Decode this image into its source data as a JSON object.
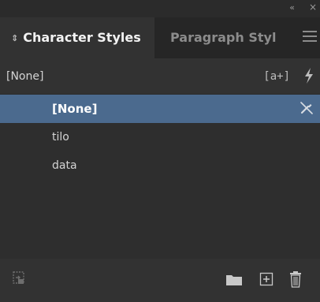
{
  "window": {
    "collapse_glyph": "«",
    "close_glyph": "×"
  },
  "tabs": [
    {
      "label": "Character Styles",
      "active": true,
      "icon": "sort-icon",
      "icon_glyph": "⇕"
    },
    {
      "label": "Paragraph Styl",
      "active": false
    }
  ],
  "menu_icon": "hamburger-menu-icon",
  "header": {
    "current_style": "[None]",
    "new_style_glyph": "[a+]",
    "new_style_icon": "create-new-style-icon",
    "quick_apply_icon": "lightning-icon"
  },
  "styles": [
    {
      "label": "[None]",
      "selected": true
    },
    {
      "label": "tilo",
      "selected": false
    },
    {
      "label": "data",
      "selected": false
    }
  ],
  "footer": {
    "icons": [
      "load-styles-icon",
      "folder-icon",
      "plus-icon",
      "trash-icon"
    ]
  },
  "colors": {
    "panel_bg": "#323232",
    "tab_bar_bg": "#262626",
    "list_bg": "#2e2e2e",
    "selection": "#4b6a8e",
    "text": "#d4d4d4",
    "inactive_text": "#8c8c8c"
  }
}
